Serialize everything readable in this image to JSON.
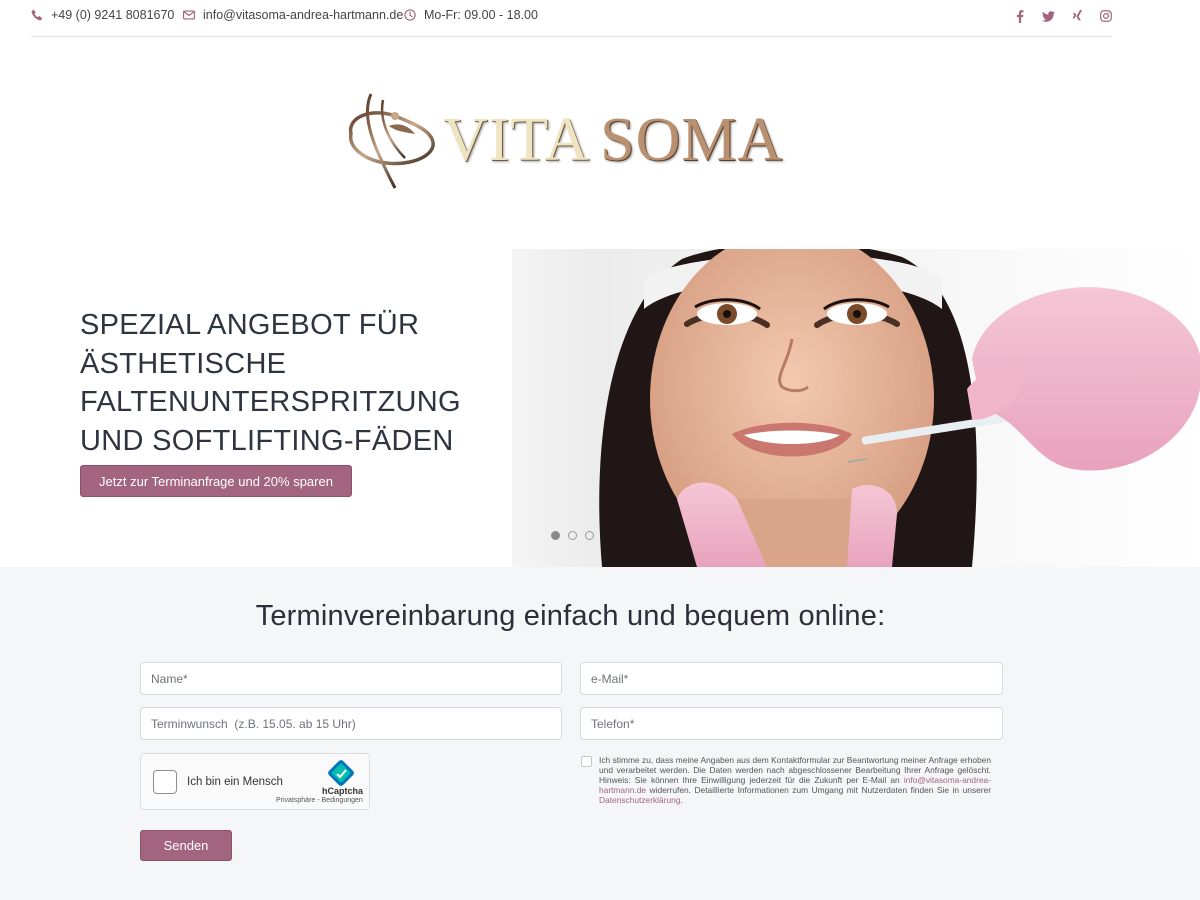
{
  "topbar": {
    "phone": "+49 (0) 9241 8081670",
    "email": "info@vitasoma-andrea-hartmann.de",
    "hours": "Mo-Fr: 09.00 - 18.00",
    "social": [
      "facebook-icon",
      "twitter-icon",
      "xing-icon",
      "instagram-icon"
    ]
  },
  "logo": {
    "part1": "VITA",
    "part2": "SOMA"
  },
  "hero": {
    "title": "SPEZIAL ANGEBOT FÜR ÄSTHETISCHE FALTENUNTERSPRITZUNG UND SOFTLIFTING-FÄDEN",
    "cta": "Jetzt zur Terminanfrage und 20% sparen",
    "slides_total": 3,
    "active_slide": 1
  },
  "form": {
    "title": "Terminvereinbarung einfach und bequem online:",
    "name_placeholder": "Name*",
    "email_placeholder": "e-Mail*",
    "termin_placeholder": "Terminwunsch  (z.B. 15.05. ab 15 Uhr)",
    "phone_placeholder": "Telefon*",
    "captcha": {
      "label": "Ich bin ein Mensch",
      "brand": "hCaptcha",
      "links": "Privatsphäre - Bedingungen"
    },
    "consent": {
      "text_1": "Ich stimme zu, dass meine Angaben aus dem Kontaktformular zur Beantwortung meiner Anfrage erhoben und verarbeitet werden. Die Daten werden nach abgeschlossener Bearbeitung Ihrer Anfrage gelöscht. Hinweis: Sie können Ihre Einwilligung jederzeit für die Zukunft per E-Mail an ",
      "email_link": "info@vitasoma-andrea-hartmann.de",
      "text_2": " widerrufen. Detaillierte Informationen zum Umgang mit Nutzerdaten finden Sie in unserer ",
      "privacy_link": "Datenschutzerklärung",
      "text_3": "."
    },
    "submit": "Senden"
  },
  "colors": {
    "accent": "#a2647e",
    "section_bg": "#f5f6f8",
    "text": "#2b2f3a"
  }
}
